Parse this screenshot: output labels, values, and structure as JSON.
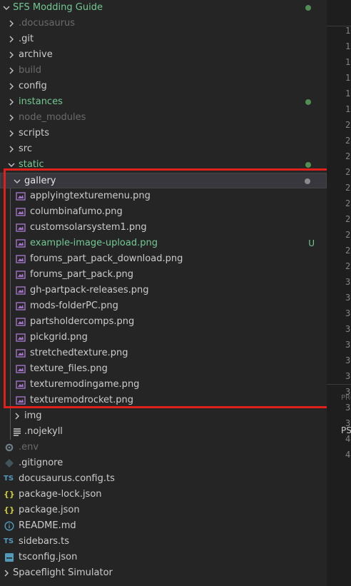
{
  "explorer": {
    "root": {
      "label": "SFS Modding Guide",
      "dot_color": "#4f8f55"
    },
    "items": [
      {
        "label": ".docusaurus",
        "style": "dim"
      },
      {
        "label": ".git",
        "style": "grey"
      },
      {
        "label": "archive",
        "style": "grey"
      },
      {
        "label": "build",
        "style": "dim"
      },
      {
        "label": "config",
        "style": "grey"
      },
      {
        "label": "instances",
        "style": "green"
      },
      {
        "label": "node_modules",
        "style": "dim"
      },
      {
        "label": "scripts",
        "style": "grey"
      },
      {
        "label": "src",
        "style": "grey"
      },
      {
        "label": "static",
        "style": "green"
      }
    ],
    "gallery": {
      "label": "gallery",
      "files": [
        {
          "label": "applyingtexturemenu.png"
        },
        {
          "label": "columbinafumo.png"
        },
        {
          "label": "customsolarsystem1.png"
        },
        {
          "label": "example-image-upload.png",
          "badge": "U"
        },
        {
          "label": "forums_part_pack_download.png"
        },
        {
          "label": "forums_part_pack.png"
        },
        {
          "label": "gh-partpack-releases.png"
        },
        {
          "label": "mods-folderPC.png"
        },
        {
          "label": "partsholdercomps.png"
        },
        {
          "label": "pickgrid.png"
        },
        {
          "label": "stretchedtexture.png"
        },
        {
          "label": "texture_files.png"
        },
        {
          "label": "texturemodingame.png"
        },
        {
          "label": "texturemodrocket.png"
        }
      ]
    },
    "static_rest": [
      {
        "label": "img"
      },
      {
        "label": ".nojekyll"
      }
    ],
    "root_files": [
      {
        "label": ".env",
        "icon": "gear-icon"
      },
      {
        "label": ".gitignore",
        "icon": "git-diamond-icon"
      },
      {
        "label": "docusaurus.config.ts",
        "icon": "ts-icon"
      },
      {
        "label": "package-lock.json",
        "icon": "json-braces-icon"
      },
      {
        "label": "package.json",
        "icon": "json-braces-icon"
      },
      {
        "label": "README.md",
        "icon": "info-icon"
      },
      {
        "label": "sidebars.ts",
        "icon": "ts-icon"
      },
      {
        "label": "tsconfig.json",
        "icon": "tsconfig-icon"
      }
    ],
    "outline": {
      "label": "Spaceflight Simulator"
    },
    "colors": {
      "green": "#73c991",
      "dim": "#6b6b6b",
      "image_icon": "#a074c4",
      "json_icon": "#cbcb41",
      "ts_icon": "#519aba",
      "info_icon": "#519aba",
      "highlight": "#e0201b"
    }
  },
  "editor": {
    "line_numbers": [
      "1",
      "1",
      "1",
      "1",
      "1",
      "1",
      "2",
      "2",
      "2",
      "2",
      "2",
      "2",
      "2",
      "2",
      "2",
      "2",
      "3",
      "3",
      "3",
      "3",
      "3",
      "3",
      "3",
      "3",
      "3",
      "3",
      "4",
      "4"
    ],
    "panel_tab": "PRO",
    "prompt": "PS"
  }
}
